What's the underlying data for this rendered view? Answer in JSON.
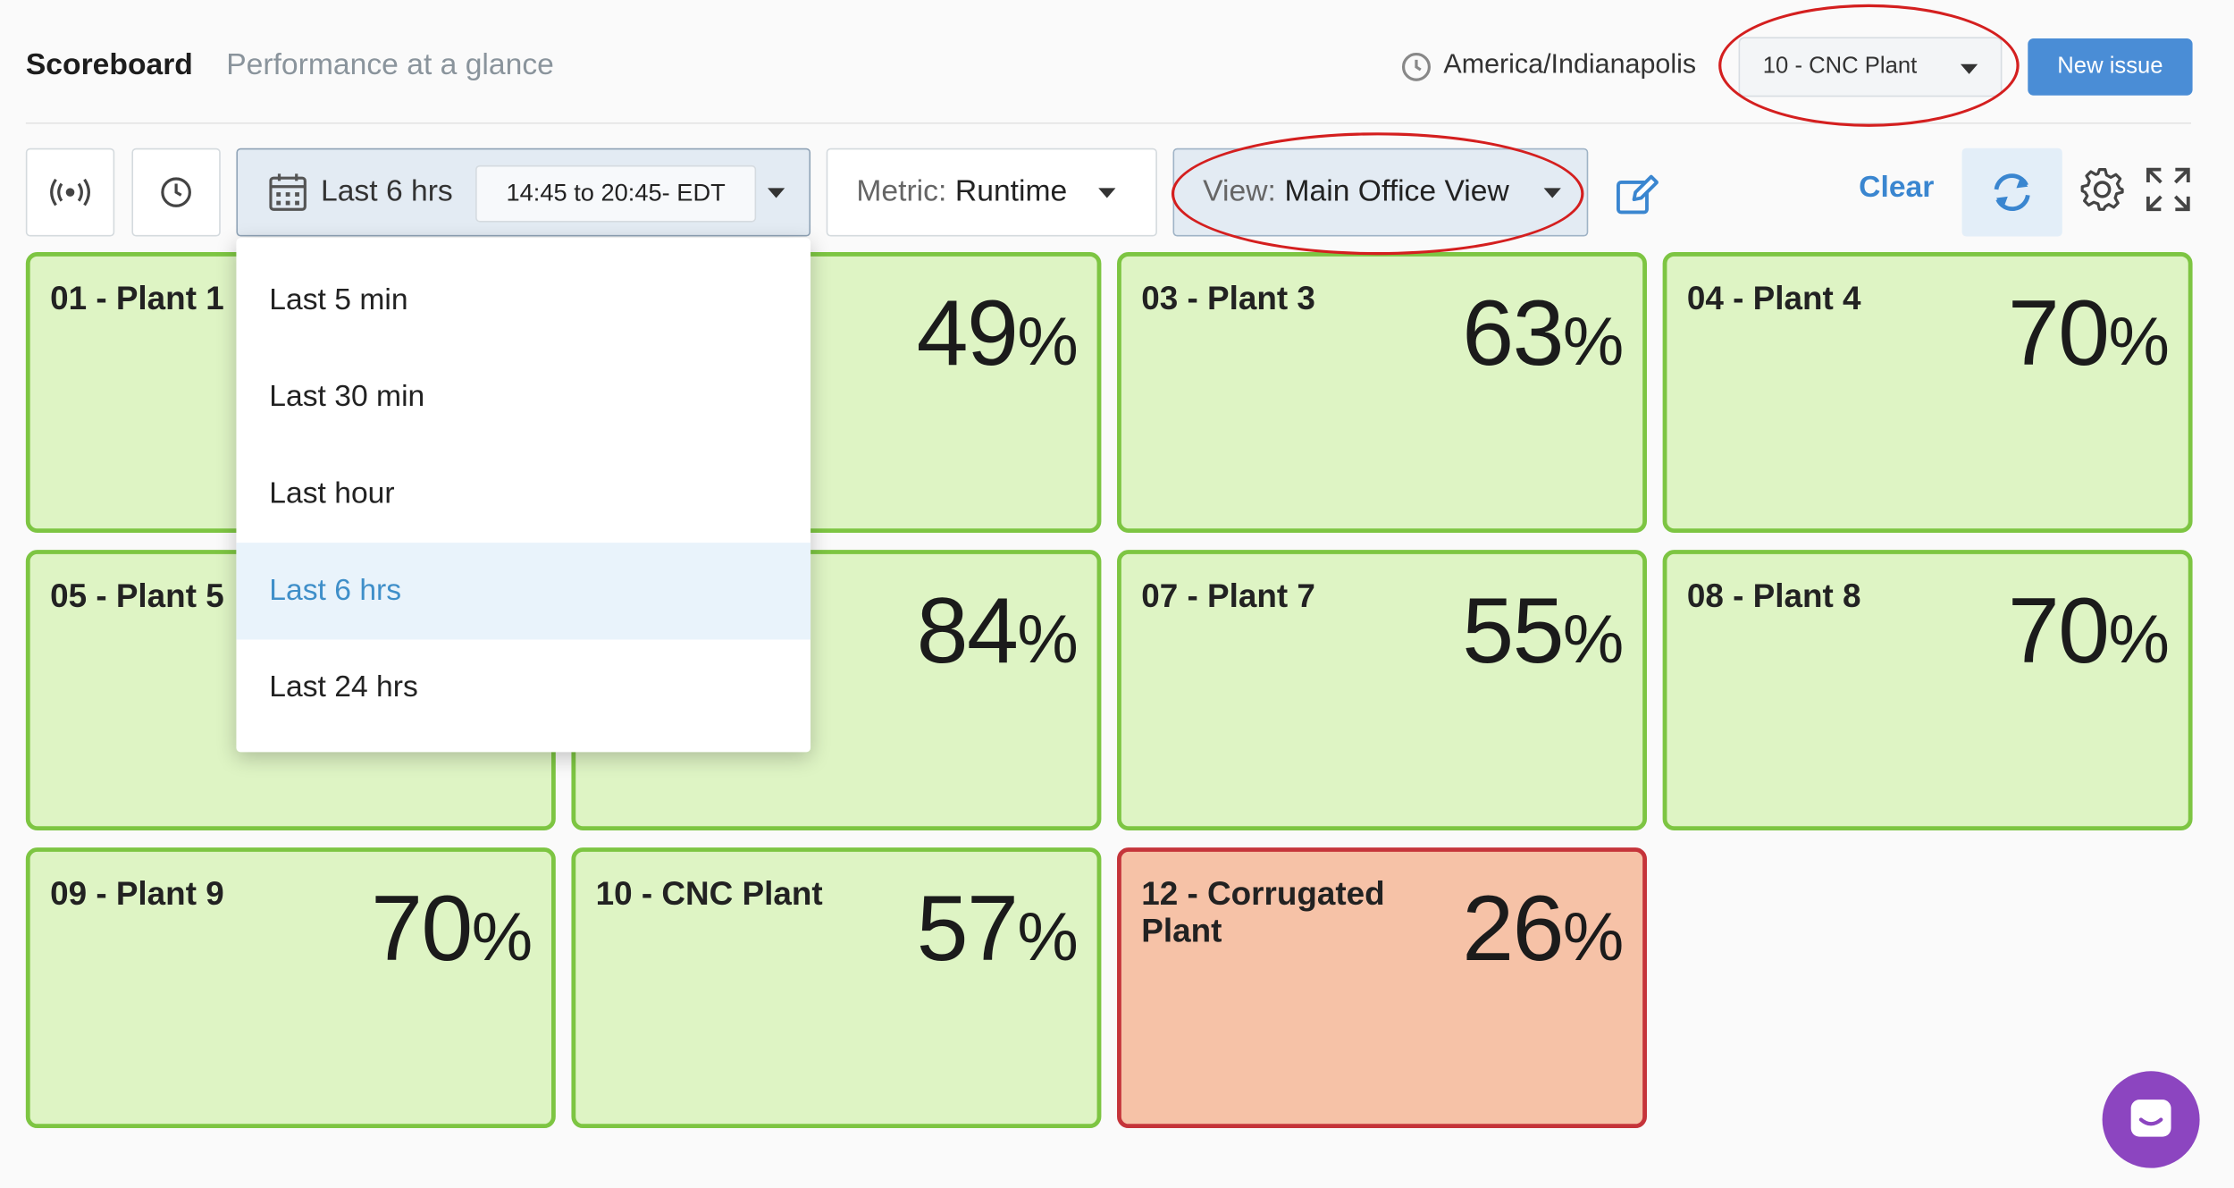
{
  "header": {
    "title": "Scoreboard",
    "subtitle": "Performance at a glance",
    "timezone": "America/Indianapolis",
    "plant_selector": "10 - CNC Plant",
    "new_issue_label": "New issue"
  },
  "toolbar": {
    "range_label": "Last 6 hrs",
    "range_time": "14:45 to 20:45- EDT",
    "metric_prefix": "Metric:",
    "metric_value": "Runtime",
    "view_prefix": "View:",
    "view_value": "Main Office View",
    "clear_label": "Clear",
    "icons": [
      "live-broadcast-icon",
      "clock-icon",
      "calendar-icon",
      "edit-icon",
      "refresh-icon",
      "gear-icon",
      "fullscreen-icon"
    ]
  },
  "dropdown": {
    "items": [
      {
        "label": "Last 5 min",
        "selected": false
      },
      {
        "label": "Last 30 min",
        "selected": false
      },
      {
        "label": "Last hour",
        "selected": false
      },
      {
        "label": "Last 6 hrs",
        "selected": true
      },
      {
        "label": "Last 24 hrs",
        "selected": false
      }
    ]
  },
  "tiles": [
    {
      "name": "01 - Plant 1",
      "value": "",
      "status": "good"
    },
    {
      "name": "",
      "value": "49",
      "status": "good"
    },
    {
      "name": "03 - Plant 3",
      "value": "63",
      "status": "good"
    },
    {
      "name": "04 - Plant 4",
      "value": "70",
      "status": "good"
    },
    {
      "name": "05 - Plant 5",
      "value": "",
      "status": "good"
    },
    {
      "name": "",
      "value": "84",
      "status": "good"
    },
    {
      "name": "07 - Plant 7",
      "value": "55",
      "status": "good"
    },
    {
      "name": "08 - Plant 8",
      "value": "70",
      "status": "good"
    },
    {
      "name": "09 - Plant 9",
      "value": "70",
      "status": "good"
    },
    {
      "name": "10 - CNC Plant",
      "value": "57",
      "status": "good"
    },
    {
      "name": "12 - Corrugated Plant",
      "value": "26",
      "status": "bad"
    }
  ],
  "percent_sign": "%",
  "colors": {
    "good_bg": "#def4c4",
    "good_border": "#7dc542",
    "bad_bg": "#f6c2a7",
    "bad_border": "#c5343a",
    "accent": "#4a8dd6",
    "annotation": "#d41f1f",
    "chat": "#8c45c0"
  }
}
